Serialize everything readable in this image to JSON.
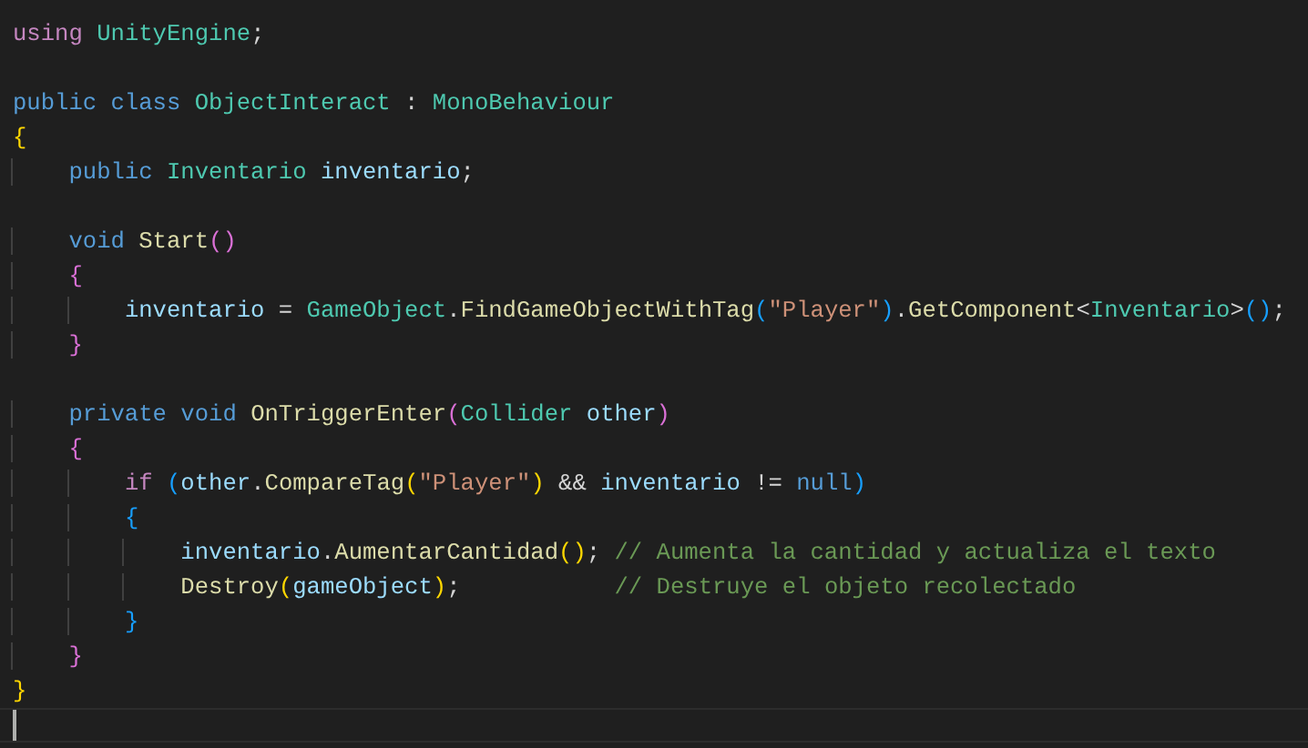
{
  "editor": {
    "lines": [
      {
        "kind": "code",
        "tokens": [
          {
            "kind": "keyword2",
            "text": "using"
          },
          {
            "kind": "type",
            "text": " UnityEngine"
          },
          {
            "kind": "plain",
            "text": ";"
          }
        ]
      },
      {
        "kind": "blank"
      },
      {
        "kind": "code",
        "tokens": [
          {
            "kind": "keyword",
            "text": "public class "
          },
          {
            "kind": "type",
            "text": "ObjectInteract"
          },
          {
            "kind": "plain",
            "text": " : "
          },
          {
            "kind": "type",
            "text": "MonoBehaviour"
          }
        ]
      },
      {
        "kind": "code",
        "tokens": [
          {
            "kind": "bracket1",
            "text": "{"
          }
        ],
        "children": [
          {
            "kind": "code",
            "tokens": [
              {
                "kind": "keyword",
                "text": "public "
              },
              {
                "kind": "type",
                "text": "Inventario "
              },
              {
                "kind": "variable",
                "text": "inventario"
              },
              {
                "kind": "plain",
                "text": ";"
              }
            ]
          },
          {
            "kind": "blank"
          },
          {
            "kind": "code",
            "tokens": [
              {
                "kind": "keyword",
                "text": "void "
              },
              {
                "kind": "function",
                "text": "Start"
              },
              {
                "kind": "bracket2",
                "text": "()"
              }
            ]
          },
          {
            "kind": "code",
            "tokens": [
              {
                "kind": "bracket2",
                "text": "{"
              }
            ],
            "children": [
              {
                "kind": "code",
                "tokens": [
                  {
                    "kind": "variable",
                    "text": "inventario"
                  },
                  {
                    "kind": "plain",
                    "text": " = "
                  },
                  {
                    "kind": "type",
                    "text": "GameObject"
                  },
                  {
                    "kind": "plain",
                    "text": "."
                  },
                  {
                    "kind": "function",
                    "text": "FindGameObjectWithTag"
                  },
                  {
                    "kind": "bracket3",
                    "text": "("
                  },
                  {
                    "kind": "string",
                    "text": "\"Player\""
                  },
                  {
                    "kind": "bracket3",
                    "text": ")"
                  },
                  {
                    "kind": "plain",
                    "text": "."
                  },
                  {
                    "kind": "function",
                    "text": "GetComponent"
                  },
                  {
                    "kind": "plain",
                    "text": "<"
                  },
                  {
                    "kind": "type",
                    "text": "Inventario"
                  },
                  {
                    "kind": "plain",
                    "text": ">"
                  },
                  {
                    "kind": "bracket3",
                    "text": "()"
                  },
                  {
                    "kind": "plain",
                    "text": ";"
                  }
                ]
              }
            ]
          },
          {
            "kind": "code",
            "tokens": [
              {
                "kind": "bracket2",
                "text": "}"
              }
            ]
          },
          {
            "kind": "blank"
          },
          {
            "kind": "code",
            "tokens": [
              {
                "kind": "keyword",
                "text": "private void "
              },
              {
                "kind": "function",
                "text": "OnTriggerEnter"
              },
              {
                "kind": "bracket2",
                "text": "("
              },
              {
                "kind": "type",
                "text": "Collider "
              },
              {
                "kind": "variable",
                "text": "other"
              },
              {
                "kind": "bracket2",
                "text": ")"
              }
            ]
          },
          {
            "kind": "code",
            "tokens": [
              {
                "kind": "bracket2",
                "text": "{"
              }
            ],
            "children": [
              {
                "kind": "code",
                "tokens": [
                  {
                    "kind": "keyword2",
                    "text": "if "
                  },
                  {
                    "kind": "bracket3",
                    "text": "("
                  },
                  {
                    "kind": "variable",
                    "text": "other"
                  },
                  {
                    "kind": "plain",
                    "text": "."
                  },
                  {
                    "kind": "function",
                    "text": "CompareTag"
                  },
                  {
                    "kind": "bracket1",
                    "text": "("
                  },
                  {
                    "kind": "string",
                    "text": "\"Player\""
                  },
                  {
                    "kind": "bracket1",
                    "text": ")"
                  },
                  {
                    "kind": "plain",
                    "text": " && "
                  },
                  {
                    "kind": "variable",
                    "text": "inventario"
                  },
                  {
                    "kind": "plain",
                    "text": " != "
                  },
                  {
                    "kind": "keyword",
                    "text": "null"
                  },
                  {
                    "kind": "bracket3",
                    "text": ")"
                  }
                ]
              },
              {
                "kind": "code",
                "tokens": [
                  {
                    "kind": "bracket3",
                    "text": "{"
                  }
                ],
                "children": [
                  {
                    "kind": "code",
                    "tokens": [
                      {
                        "kind": "variable",
                        "text": "inventario"
                      },
                      {
                        "kind": "plain",
                        "text": "."
                      },
                      {
                        "kind": "function",
                        "text": "AumentarCantidad"
                      },
                      {
                        "kind": "bracket1",
                        "text": "()"
                      },
                      {
                        "kind": "plain",
                        "text": "; "
                      },
                      {
                        "kind": "comment",
                        "text": "// Aumenta la cantidad y actualiza el texto"
                      }
                    ]
                  },
                  {
                    "kind": "code",
                    "tokens": [
                      {
                        "kind": "function",
                        "text": "Destroy"
                      },
                      {
                        "kind": "bracket1",
                        "text": "("
                      },
                      {
                        "kind": "variable",
                        "text": "gameObject"
                      },
                      {
                        "kind": "bracket1",
                        "text": ")"
                      },
                      {
                        "kind": "plain",
                        "text": ";           "
                      },
                      {
                        "kind": "comment",
                        "text": "// Destruye el objeto recolectado"
                      }
                    ]
                  }
                ]
              },
              {
                "kind": "code",
                "tokens": [
                  {
                    "kind": "bracket3",
                    "text": "}"
                  }
                ]
              }
            ]
          },
          {
            "kind": "code",
            "tokens": [
              {
                "kind": "bracket2",
                "text": "}"
              }
            ]
          }
        ]
      },
      {
        "kind": "code",
        "tokens": [
          {
            "kind": "bracket1",
            "text": "}"
          }
        ]
      },
      {
        "kind": "cursor"
      }
    ]
  }
}
